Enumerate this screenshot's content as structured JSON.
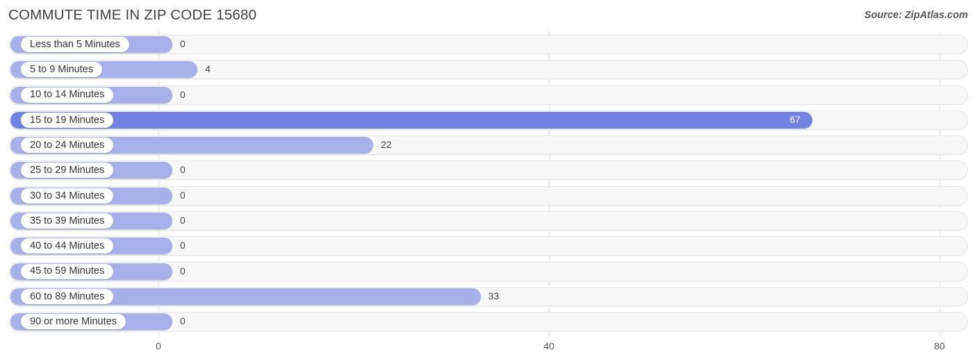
{
  "header": {
    "title": "COMMUTE TIME IN ZIP CODE 15680",
    "source": "Source: ZipAtlas.com"
  },
  "chart_data": {
    "type": "bar",
    "orientation": "horizontal",
    "title": "COMMUTE TIME IN ZIP CODE 15680",
    "subtitle": "",
    "xlabel": "",
    "ylabel": "",
    "xlim": [
      0,
      80
    ],
    "xticks": [
      0,
      40,
      80
    ],
    "xtick_labels": [
      "0",
      "40",
      "80"
    ],
    "grid": true,
    "legend": null,
    "highlight_color": "#7282e0",
    "bar_color": "#a7b0e8",
    "track_color": "#f7f7f7",
    "categories": [
      "Less than 5 Minutes",
      "5 to 9 Minutes",
      "10 to 14 Minutes",
      "15 to 19 Minutes",
      "20 to 24 Minutes",
      "25 to 29 Minutes",
      "30 to 34 Minutes",
      "35 to 39 Minutes",
      "40 to 44 Minutes",
      "45 to 59 Minutes",
      "60 to 89 Minutes",
      "90 or more Minutes"
    ],
    "values": [
      0,
      4,
      0,
      67,
      22,
      0,
      0,
      0,
      0,
      0,
      33,
      0
    ],
    "value_labels": [
      "0",
      "4",
      "0",
      "67",
      "22",
      "0",
      "0",
      "0",
      "0",
      "0",
      "33",
      "0"
    ]
  }
}
